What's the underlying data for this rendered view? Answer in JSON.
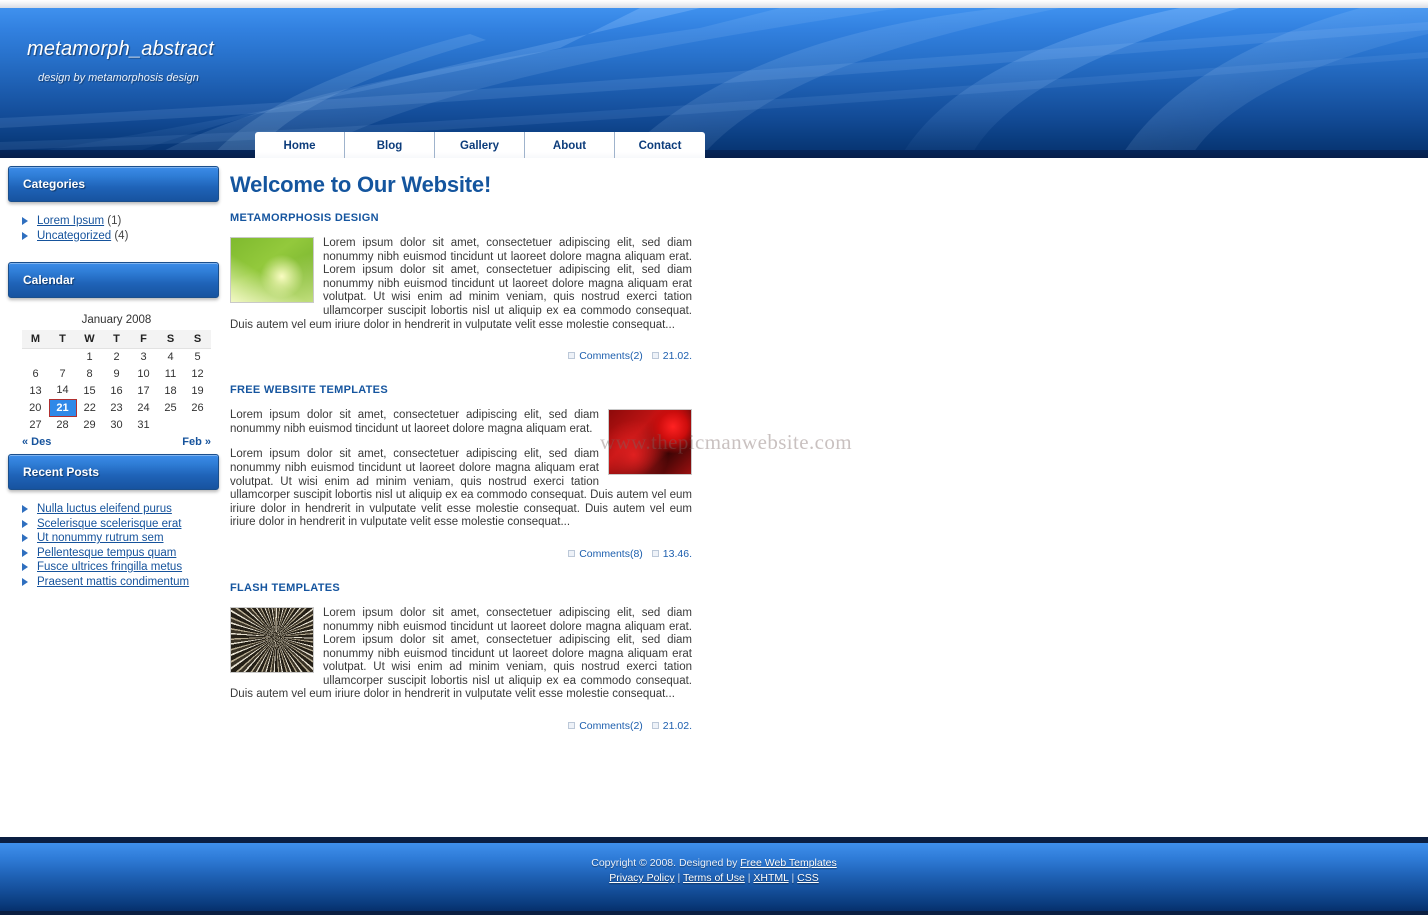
{
  "site": {
    "title": "metamorph_abstract",
    "tagline": "design by metamorphosis design"
  },
  "nav": {
    "items": [
      {
        "label": "Home"
      },
      {
        "label": "Blog"
      },
      {
        "label": "Gallery"
      },
      {
        "label": "About"
      },
      {
        "label": "Contact"
      }
    ]
  },
  "sidebar": {
    "categories": {
      "heading": "Categories",
      "items": [
        {
          "label": "Lorem Ipsum",
          "count": "(1)"
        },
        {
          "label": "Uncategorized",
          "count": "(4)"
        }
      ]
    },
    "calendar": {
      "heading": "Calendar",
      "caption": "January 2008",
      "weekdays": [
        "M",
        "T",
        "W",
        "T",
        "F",
        "S",
        "S"
      ],
      "weeks": [
        [
          "",
          "",
          "1",
          "2",
          "3",
          "4",
          "5"
        ],
        [
          "6",
          "7",
          "8",
          "9",
          "10",
          "11",
          "12"
        ],
        [
          "13",
          "14",
          "15",
          "16",
          "17",
          "18",
          "19"
        ],
        [
          "20",
          "21",
          "22",
          "23",
          "24",
          "25",
          "26"
        ],
        [
          "27",
          "28",
          "29",
          "30",
          "31",
          "",
          ""
        ]
      ],
      "today": "21",
      "prev_label": "« Des",
      "next_label": "Feb »"
    },
    "recent_posts": {
      "heading": "Recent Posts",
      "items": [
        {
          "label": "Nulla luctus eleifend purus"
        },
        {
          "label": "Scelerisque scelerisque erat"
        },
        {
          "label": "Ut nonummy rutrum sem"
        },
        {
          "label": "Pellentesque tempus quam"
        },
        {
          "label": "Fusce ultrices fringilla metus"
        },
        {
          "label": "Praesent mattis condimentum"
        }
      ]
    }
  },
  "main": {
    "page_title": "Welcome to Our Website!",
    "watermark": "www.thepicmanwebsite.com",
    "posts": [
      {
        "title": "METAMORPHOSIS DESIGN",
        "thumb": "green-abstract-thumbnail",
        "thumb_side": "left",
        "paragraphs": [
          "Lorem ipsum dolor sit amet, consectetuer adipiscing elit, sed diam nonummy nibh euismod tincidunt ut laoreet dolore magna aliquam erat. Lorem ipsum dolor sit amet, consectetuer adipiscing elit, sed diam nonummy nibh euismod tincidunt ut laoreet dolore magna aliquam erat volutpat. Ut wisi enim ad minim veniam, quis nostrud exerci tation ullamcorper suscipit lobortis nisl ut aliquip ex ea commodo consequat. Duis autem vel eum iriure dolor in hendrerit in vulputate velit esse molestie consequat..."
        ],
        "comments": "Comments(2)",
        "time": "21.02."
      },
      {
        "title": "FREE WEBSITE TEMPLATES",
        "thumb": "red-abstract-thumbnail",
        "thumb_side": "right",
        "paragraphs": [
          "Lorem ipsum dolor sit amet, consectetuer adipiscing elit, sed diam nonummy nibh euismod tincidunt ut laoreet dolore magna aliquam erat.",
          "Lorem ipsum dolor sit amet, consectetuer adipiscing elit, sed diam nonummy nibh euismod tincidunt ut laoreet dolore magna aliquam erat volutpat. Ut wisi enim ad minim veniam, quis nostrud exerci tation ullamcorper suscipit lobortis nisl ut aliquip ex ea commodo consequat. Duis autem vel eum iriure dolor in hendrerit in vulputate velit esse molestie consequat. Duis autem vel eum iriure dolor in hendrerit in vulputate velit esse molestie consequat..."
        ],
        "comments": "Comments(8)",
        "time": "13.46."
      },
      {
        "title": "FLASH TEMPLATES",
        "thumb": "sepia-abstract-thumbnail",
        "thumb_side": "left",
        "paragraphs": [
          "Lorem ipsum dolor sit amet, consectetuer adipiscing elit, sed diam nonummy nibh euismod tincidunt ut laoreet dolore magna aliquam erat. Lorem ipsum dolor sit amet, consectetuer adipiscing elit, sed diam nonummy nibh euismod tincidunt ut laoreet dolore magna aliquam erat volutpat. Ut wisi enim ad minim veniam, quis nostrud exerci tation ullamcorper suscipit lobortis nisl ut aliquip ex ea commodo consequat. Duis autem vel eum iriure dolor in hendrerit in vulputate velit esse molestie consequat..."
        ],
        "comments": "Comments(2)",
        "time": "21.02."
      }
    ]
  },
  "footer": {
    "copyright": "Copyright © 2008. Designed by",
    "designer_link": "Free Web Templates",
    "links": [
      {
        "label": "Privacy Policy"
      },
      {
        "label": "Terms of Use"
      },
      {
        "label": "XHTML"
      },
      {
        "label": "CSS"
      }
    ],
    "separator": "|"
  },
  "colors": {
    "brand_blue": "#14559e",
    "header_light": "#3f91ee",
    "header_dark": "#06306c",
    "link_blue": "#16539c",
    "today_bg": "#2f89e8",
    "today_border": "#b03030"
  }
}
